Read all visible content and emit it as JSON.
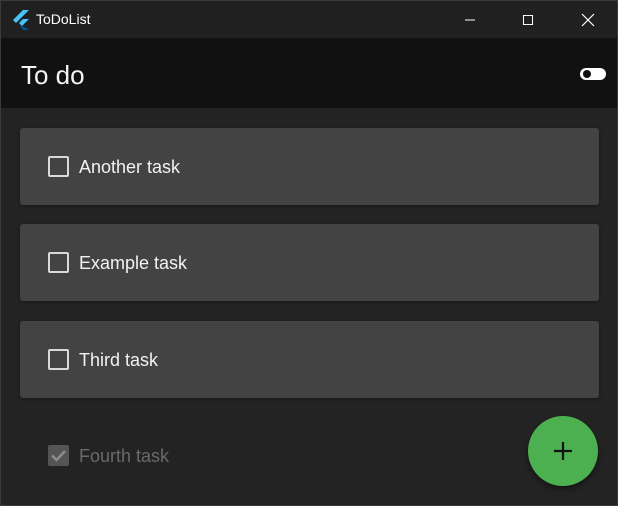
{
  "window": {
    "title": "ToDoList",
    "controls": [
      "minimize",
      "maximize",
      "close"
    ]
  },
  "appbar": {
    "title": "To do",
    "theme_toggle_icon": "toggle-icon"
  },
  "tasks": [
    {
      "label": "Another task",
      "checked": false
    },
    {
      "label": "Example task",
      "checked": false
    },
    {
      "label": "Third task",
      "checked": false
    },
    {
      "label": "Fourth task",
      "checked": true
    }
  ],
  "fab": {
    "icon": "plus-icon"
  },
  "colors": {
    "titlebar": "#202020",
    "appbar": "#111111",
    "background": "#232323",
    "card": "#434343",
    "accent": "#4caf50"
  }
}
